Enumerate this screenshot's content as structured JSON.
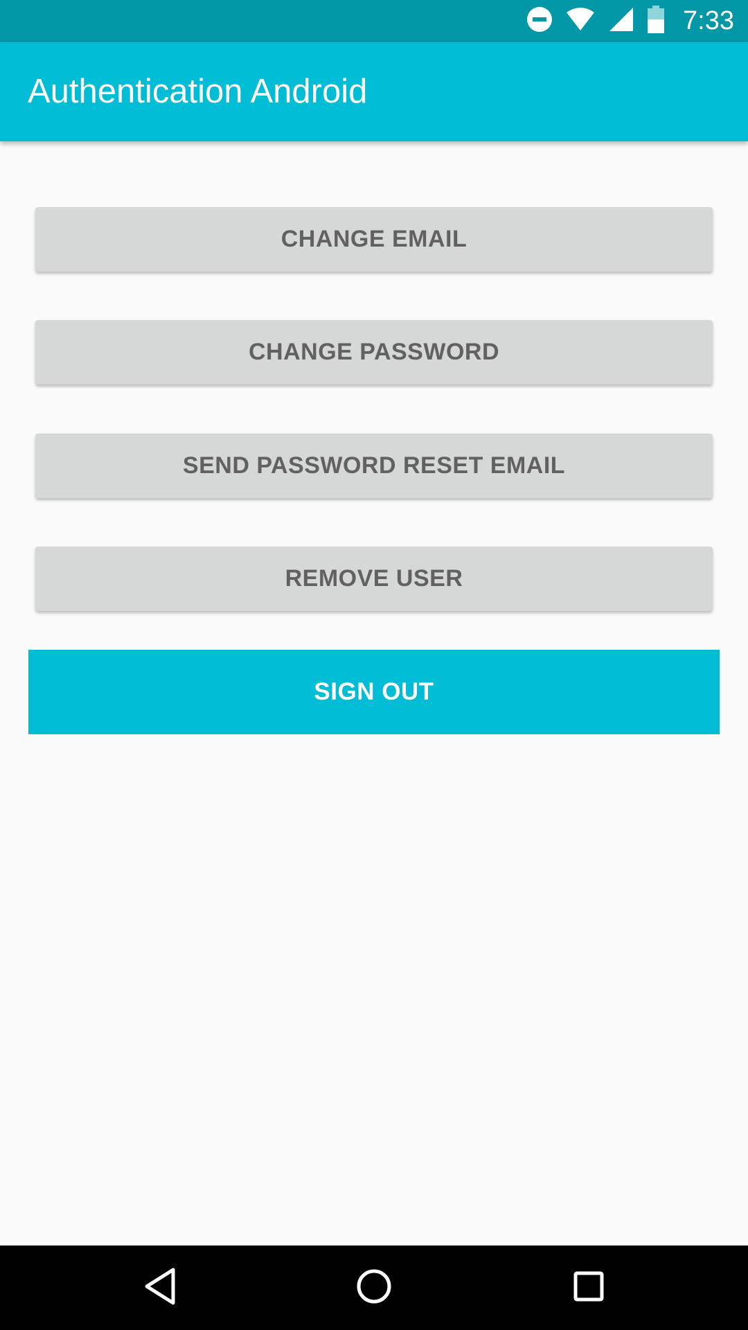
{
  "status_bar": {
    "time": "7:33",
    "icons": [
      "do-not-disturb-icon",
      "wifi-icon",
      "cell-signal-icon",
      "battery-icon"
    ],
    "background": "#0097a7"
  },
  "app_bar": {
    "title": "Authentication Android",
    "background": "#00bcd4"
  },
  "actions": {
    "change_email": "CHANGE EMAIL",
    "change_password": "CHANGE PASSWORD",
    "send_reset_email": "SEND PASSWORD RESET EMAIL",
    "remove_user": "REMOVE USER",
    "sign_out": "SIGN OUT"
  },
  "colors": {
    "accent": "#00bcd4",
    "button_gray": "#d6d7d7",
    "button_text": "#616161",
    "background": "#fafafa"
  },
  "nav_bar": {
    "icons": [
      "back-icon",
      "home-icon",
      "recents-icon"
    ]
  }
}
